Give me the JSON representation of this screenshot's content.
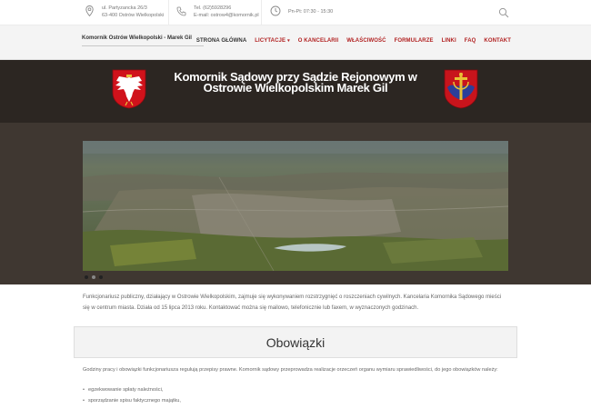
{
  "topbar": {
    "address": {
      "line1": "ul. Partyzancka 26/3",
      "line2": "63-400 Ostrów Wielkopolski",
      "icon": "map-pin-icon"
    },
    "contact": {
      "line1": "Tel. (62)5928296",
      "line2": "E-mail: ostrow4@komornik.pl",
      "icon": "phone-icon"
    },
    "hours": {
      "text": "Pn-Pt: 07:30 - 15:30",
      "icon": "clock-icon"
    },
    "search_icon": "search-icon"
  },
  "navbar": {
    "brand": "Komornik Ostrów Wielkopolski - Marek Gil",
    "items": [
      {
        "label": "STRONA GŁÓWNA",
        "active": true
      },
      {
        "label": "LICYTACJE",
        "dropdown": true
      },
      {
        "label": "O KANCELARII"
      },
      {
        "label": "WŁAŚCIWOŚĆ"
      },
      {
        "label": "FORMULARZE"
      },
      {
        "label": "LINKI"
      },
      {
        "label": "FAQ"
      },
      {
        "label": "KONTAKT"
      }
    ],
    "caret": "▾"
  },
  "hero": {
    "title_line1": "Komornik Sądowy przy Sądzie Rejonowym w",
    "title_line2": "Ostrowie Wielkopolskim Marek Gil",
    "left_emblem": "polish-eagle-emblem",
    "right_emblem": "city-coat-of-arms"
  },
  "slider": {
    "image": "aerial-city-photo",
    "dots": 3,
    "active_dot": 2
  },
  "intro": "Funkcjonariusz publiczny, działający w Ostrowie Wielkopolskim, zajmuje się wykonywaniem rozstrzygnięć o roszczeniach cywilnych. Kancelaria Komornika Sądowego mieści się w centrum miasta. Działa od 15 lipca 2013 roku. Kontaktować można się mailowo, telefonicznie lub faxem, w wyznaczonych godzinach.",
  "section": {
    "heading": "Obowiązki",
    "text": "Godziny pracy i obowiązki funkcjonariusza regulują przepisy prawne. Komornik sądowy przeprowadza realizacje orzeczeń organu wymiaru sprawiedliwości, do jego obowiązków należy:",
    "list": [
      "egzekwowanie spłaty należności,",
      "sporządzanie spisu faktycznego majątku,"
    ]
  },
  "colors": {
    "accent": "#b22222",
    "hero_bg": "#2c2622",
    "band_bg": "#3f3731"
  }
}
